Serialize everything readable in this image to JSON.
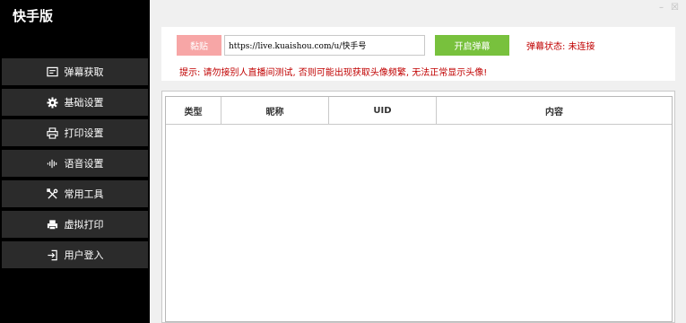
{
  "app": {
    "title": "快手版"
  },
  "window": {
    "minimize": "–",
    "close": "☒"
  },
  "sidebar": {
    "items": [
      {
        "label": "弹幕获取",
        "icon": "monitor-icon"
      },
      {
        "label": "基础设置",
        "icon": "gear-icon"
      },
      {
        "label": "打印设置",
        "icon": "printer-icon"
      },
      {
        "label": "语音设置",
        "icon": "audio-wave-icon"
      },
      {
        "label": "常用工具",
        "icon": "tools-icon"
      },
      {
        "label": "虚拟打印",
        "icon": "virtual-printer-icon"
      },
      {
        "label": "用户登入",
        "icon": "login-icon"
      }
    ]
  },
  "controls": {
    "paste_label": "黏贴",
    "url_value": "https://live.kuaishou.com/u/快手号",
    "start_label": "开启弹幕",
    "status_text": "弹幕状态: 未连接",
    "tip_text": "提示: 请勿接别人直播间测试, 否则可能出现获取头像频繁, 无法正常显示头像!"
  },
  "table": {
    "columns": [
      "类型",
      "昵称",
      "UID",
      "内容"
    ],
    "rows": []
  },
  "colors": {
    "sidebar_bg": "#000000",
    "nav_item_bg": "#2b2b2b",
    "paste_button": "#f7a6a6",
    "start_button": "#78c13d",
    "warning_text": "#c00000"
  }
}
